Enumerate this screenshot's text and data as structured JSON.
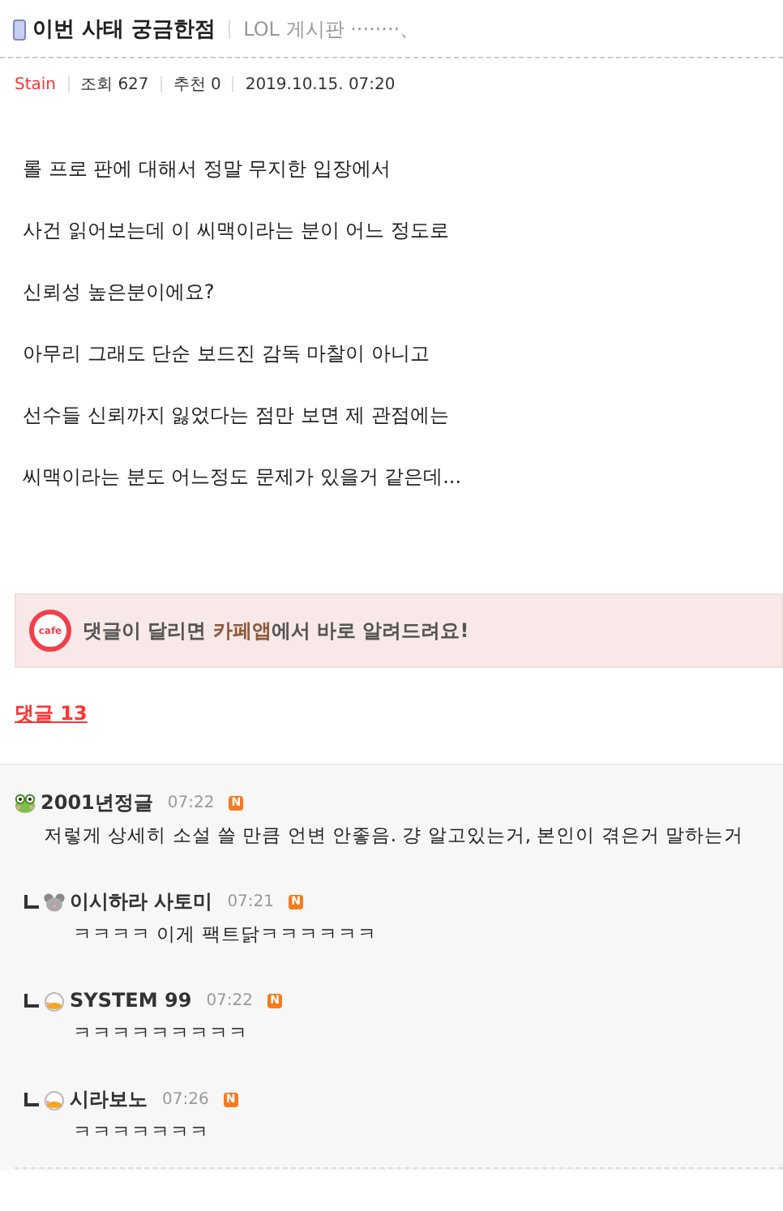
{
  "post": {
    "title": "이번 사태 궁금한점",
    "board": "LOL 게시판 ········、",
    "author": "Stain",
    "views": "조회 627",
    "likes": "추천 0",
    "date": "2019.10.15. 07:20",
    "body": [
      "롤 프로 판에 대해서 정말 무지한 입장에서",
      "사건 읽어보는데 이 씨맥이라는 분이 어느 정도로",
      "신뢰성 높은분이에요?",
      "아무리 그래도 단순 보드진 감독 마찰이 아니고",
      "선수들 신뢰까지 잃었다는 점만 보면 제 관점에는",
      "씨맥이라는 분도 어느정도 문제가 있을거 같은데..."
    ]
  },
  "banner": {
    "icon_text": "cafe",
    "message": "댓글이 달리면 **카페앱**에서 바로 알려드려요!"
  },
  "comments_link": "댓글 13",
  "comments": [
    {
      "kind": "comment",
      "avatar": {
        "kind": "frog"
      },
      "author": "2001년정글",
      "time": "07:22",
      "new_badge": "N",
      "text": "저렇게 상세히 소설 쓸 만큼 언변 안좋음. 걍 알고있는거, 본인이 겪은거 말하는거"
    },
    {
      "kind": "reply",
      "avatar": {
        "kind": "mouse"
      },
      "author": "이시하라 사토미",
      "time": "07:21",
      "new_badge": "N",
      "text": "ㅋㅋㅋㅋ 이게 팩트닭ㅋㅋㅋㅋㅋㅋ"
    },
    {
      "kind": "reply",
      "avatar": {
        "kind": "duck"
      },
      "author": "SYSTEM 99",
      "time": "07:22",
      "new_badge": "N",
      "text": "ㅋㅋㅋㅋㅋㅋㅋㅋㅋ"
    },
    {
      "kind": "reply",
      "avatar": {
        "kind": "duck"
      },
      "author": "시라보노",
      "time": "07:26",
      "new_badge": "N",
      "text": "ㅋㅋㅋㅋㅋㅋㅋ"
    }
  ]
}
